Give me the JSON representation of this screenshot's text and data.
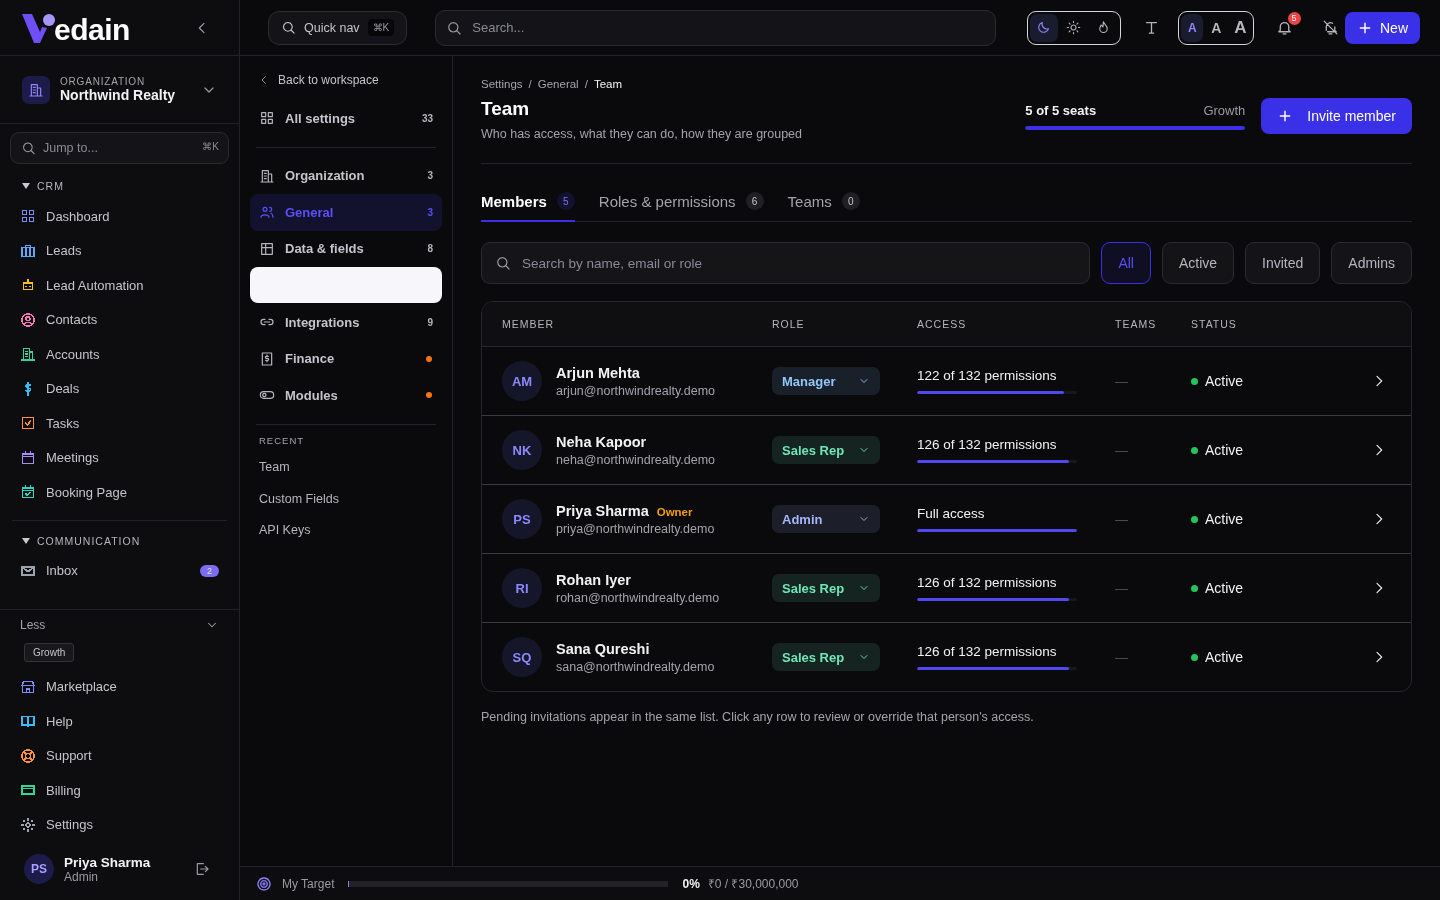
{
  "sidebar": {
    "logo": "edain",
    "organization": {
      "label": "ORGANIZATION",
      "name": "Northwind Realty"
    },
    "jump": {
      "placeholder": "Jump to...",
      "shortcut": "⌘K"
    },
    "sections": [
      {
        "title": "CRM",
        "expanded": true,
        "items": [
          {
            "label": "Dashboard",
            "color": "#818cf8"
          },
          {
            "label": "Leads",
            "color": "#60a5fa"
          },
          {
            "label": "Lead Automation",
            "color": "#fbbf24"
          },
          {
            "label": "Contacts",
            "color": "#f472b6"
          },
          {
            "label": "Accounts",
            "color": "#34d399"
          },
          {
            "label": "Deals",
            "color": "#38bdf8"
          },
          {
            "label": "Tasks",
            "color": "#fb923c"
          },
          {
            "label": "Meetings",
            "color": "#a78bfa"
          },
          {
            "label": "Booking Page",
            "color": "#2dd4bf"
          }
        ]
      },
      {
        "title": "COMMUNICATION",
        "expanded": true,
        "items": [
          {
            "label": "Inbox",
            "color": "#9ca3af",
            "badge": "2"
          }
        ]
      }
    ],
    "less": "Less",
    "plan": "Growth",
    "bottom_items": [
      {
        "label": "Marketplace",
        "color": "#818cf8"
      },
      {
        "label": "Help",
        "color": "#38bdf8"
      },
      {
        "label": "Support",
        "color": "#fb923c"
      },
      {
        "label": "Billing",
        "color": "#34d399"
      },
      {
        "label": "Settings",
        "color": "#9ca3af"
      }
    ],
    "user": {
      "initials": "PS",
      "name": "Priya Sharma",
      "role": "Admin"
    }
  },
  "topbar": {
    "quick_nav": {
      "label": "Quick nav",
      "shortcut": "⌘K"
    },
    "search": {
      "placeholder": "Search..."
    },
    "theme": [
      {
        "selected": true
      },
      {
        "selected": false
      },
      {
        "selected": false
      }
    ],
    "font_size": [
      {
        "label": "A",
        "selected": true
      },
      {
        "label": "A",
        "selected": false
      },
      {
        "label": "A",
        "selected": false
      }
    ],
    "notifications": "5",
    "new_button": "New"
  },
  "settings_nav": {
    "back": "Back to workspace",
    "all": {
      "label": "All settings",
      "count": "33"
    },
    "items": [
      {
        "kind": "item",
        "label": "Organization",
        "count": "3",
        "selected": false
      },
      {
        "kind": "item",
        "label": "General",
        "count": "3",
        "selected": true
      },
      {
        "kind": "item",
        "label": "Data & fields",
        "count": "8",
        "selected": false
      },
      {
        "kind": "blank"
      },
      {
        "kind": "item",
        "label": "Integrations",
        "count": "9",
        "selected": false
      },
      {
        "kind": "dot",
        "label": "Finance",
        "selected": false
      },
      {
        "kind": "dot",
        "label": "Modules",
        "selected": false
      }
    ],
    "recent_title": "RECENT",
    "recent": [
      "Team",
      "Custom Fields",
      "API Keys"
    ]
  },
  "main": {
    "breadcrumb": [
      "Settings",
      "General",
      "Team"
    ],
    "breadcrumb_separator": "/",
    "title": "Team",
    "subtitle": "Who has access, what they can do, how they are grouped",
    "seats": {
      "label": "5 of 5 seats",
      "plan": "Growth",
      "level": 1
    },
    "invite_button": "Invite member",
    "tabs": [
      {
        "label": "Members",
        "count": "5",
        "selected": true
      },
      {
        "label": "Roles & permissions",
        "count": "6",
        "selected": false
      },
      {
        "label": "Teams",
        "count": "0",
        "selected": false
      }
    ],
    "search": {
      "placeholder": "Search by name, email or role"
    },
    "filters": [
      {
        "label": "All",
        "selected": true
      },
      {
        "label": "Active",
        "selected": false
      },
      {
        "label": "Invited",
        "selected": false
      },
      {
        "label": "Admins",
        "selected": false
      }
    ],
    "table": {
      "columns": [
        "MEMBER",
        "ROLE",
        "ACCESS",
        "TEAMS",
        "STATUS"
      ],
      "rows": [
        {
          "initials": "AM",
          "name": "Arjun Mehta",
          "email": "arjun@northwindrealty.demo",
          "role": {
            "label": "Manager",
            "color": "#93c5fd"
          },
          "access": "122 of 132 permissions",
          "level": 0.92,
          "teams": "—",
          "status": "Active"
        },
        {
          "initials": "NK",
          "name": "Neha Kapoor",
          "email": "neha@northwindrealty.demo",
          "role": {
            "label": "Sales Rep",
            "color": "#6ee7b7"
          },
          "access": "126 of 132 permissions",
          "level": 0.95,
          "teams": "—",
          "status": "Active"
        },
        {
          "initials": "PS",
          "name": "Priya Sharma",
          "tag": "Owner",
          "email": "priya@northwindrealty.demo",
          "role": {
            "label": "Admin",
            "color": "#a5b4fc"
          },
          "access": "Full access",
          "level": 1,
          "teams": "—",
          "status": "Active"
        },
        {
          "initials": "RI",
          "name": "Rohan Iyer",
          "email": "rohan@northwindrealty.demo",
          "role": {
            "label": "Sales Rep",
            "color": "#6ee7b7"
          },
          "access": "126 of 132 permissions",
          "level": 0.95,
          "teams": "—",
          "status": "Active"
        },
        {
          "initials": "SQ",
          "name": "Sana Qureshi",
          "email": "sana@northwindrealty.demo",
          "role": {
            "label": "Sales Rep",
            "color": "#6ee7b7"
          },
          "access": "126 of 132 permissions",
          "level": 0.95,
          "teams": "—",
          "status": "Active"
        }
      ]
    },
    "note": "Pending invitations appear in the same list. Click any row to review or override that person's access."
  },
  "status_bar": {
    "label": "My Target",
    "level": 0,
    "percent": "0%",
    "amount": "₹0 / ₹30,000,000"
  }
}
